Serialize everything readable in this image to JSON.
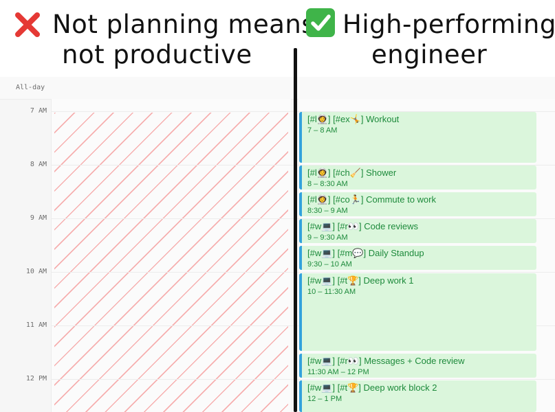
{
  "header": {
    "left_line1": "Not planning means",
    "left_line2": "not productive",
    "right_line1": "High-performing",
    "right_line2": "engineer"
  },
  "icons": {
    "left": "red-cross-icon",
    "right": "green-check-icon"
  },
  "colors": {
    "cross": "#e53935",
    "check": "#3fb449",
    "event_bg": "#dbf6dc",
    "event_bar": "#33a2dc",
    "event_text": "#1d8a3b",
    "hatch": "#f59696"
  },
  "calendar": {
    "allday_label": "All-day",
    "time_labels": [
      "7 AM",
      "8 AM",
      "9 AM",
      "10 AM",
      "11 AM",
      "12 PM"
    ],
    "events": [
      {
        "title": "[#l👩‍🚀] [#ex🤸] Workout",
        "time": "7 – 8 AM"
      },
      {
        "title": "[#l👩‍🚀] [#ch🧹] Shower",
        "time": "8 – 8:30 AM"
      },
      {
        "title": "[#l👩‍🚀] [#co🏃] Commute to work",
        "time": "8:30 – 9 AM"
      },
      {
        "title": "[#w💻] [#r👀] Code reviews",
        "time": "9 – 9:30 AM"
      },
      {
        "title": "[#w💻] [#m💬] Daily Standup",
        "time": "9:30 – 10 AM"
      },
      {
        "title": "[#w💻] [#t🏆] Deep work 1",
        "time": "10 – 11:30 AM"
      },
      {
        "title": "[#w💻] [#r👀] Messages + Code review",
        "time": "11:30 AM – 12 PM"
      },
      {
        "title": "[#w💻] [#t🏆] Deep work block 2",
        "time": "12 – 1 PM"
      }
    ]
  }
}
